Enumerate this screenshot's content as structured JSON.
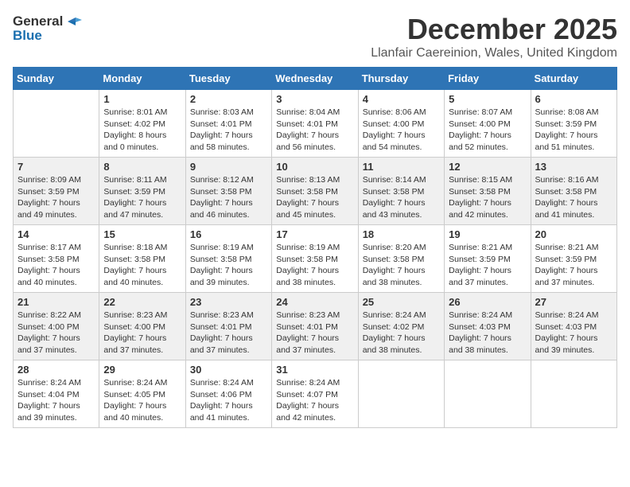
{
  "header": {
    "logo_general": "General",
    "logo_blue": "Blue",
    "month_title": "December 2025",
    "location": "Llanfair Caereinion, Wales, United Kingdom"
  },
  "days_of_week": [
    "Sunday",
    "Monday",
    "Tuesday",
    "Wednesday",
    "Thursday",
    "Friday",
    "Saturday"
  ],
  "weeks": [
    [
      {
        "day": "",
        "info": ""
      },
      {
        "day": "1",
        "info": "Sunrise: 8:01 AM\nSunset: 4:02 PM\nDaylight: 8 hours\nand 0 minutes."
      },
      {
        "day": "2",
        "info": "Sunrise: 8:03 AM\nSunset: 4:01 PM\nDaylight: 7 hours\nand 58 minutes."
      },
      {
        "day": "3",
        "info": "Sunrise: 8:04 AM\nSunset: 4:01 PM\nDaylight: 7 hours\nand 56 minutes."
      },
      {
        "day": "4",
        "info": "Sunrise: 8:06 AM\nSunset: 4:00 PM\nDaylight: 7 hours\nand 54 minutes."
      },
      {
        "day": "5",
        "info": "Sunrise: 8:07 AM\nSunset: 4:00 PM\nDaylight: 7 hours\nand 52 minutes."
      },
      {
        "day": "6",
        "info": "Sunrise: 8:08 AM\nSunset: 3:59 PM\nDaylight: 7 hours\nand 51 minutes."
      }
    ],
    [
      {
        "day": "7",
        "info": "Sunrise: 8:09 AM\nSunset: 3:59 PM\nDaylight: 7 hours\nand 49 minutes."
      },
      {
        "day": "8",
        "info": "Sunrise: 8:11 AM\nSunset: 3:59 PM\nDaylight: 7 hours\nand 47 minutes."
      },
      {
        "day": "9",
        "info": "Sunrise: 8:12 AM\nSunset: 3:58 PM\nDaylight: 7 hours\nand 46 minutes."
      },
      {
        "day": "10",
        "info": "Sunrise: 8:13 AM\nSunset: 3:58 PM\nDaylight: 7 hours\nand 45 minutes."
      },
      {
        "day": "11",
        "info": "Sunrise: 8:14 AM\nSunset: 3:58 PM\nDaylight: 7 hours\nand 43 minutes."
      },
      {
        "day": "12",
        "info": "Sunrise: 8:15 AM\nSunset: 3:58 PM\nDaylight: 7 hours\nand 42 minutes."
      },
      {
        "day": "13",
        "info": "Sunrise: 8:16 AM\nSunset: 3:58 PM\nDaylight: 7 hours\nand 41 minutes."
      }
    ],
    [
      {
        "day": "14",
        "info": "Sunrise: 8:17 AM\nSunset: 3:58 PM\nDaylight: 7 hours\nand 40 minutes."
      },
      {
        "day": "15",
        "info": "Sunrise: 8:18 AM\nSunset: 3:58 PM\nDaylight: 7 hours\nand 40 minutes."
      },
      {
        "day": "16",
        "info": "Sunrise: 8:19 AM\nSunset: 3:58 PM\nDaylight: 7 hours\nand 39 minutes."
      },
      {
        "day": "17",
        "info": "Sunrise: 8:19 AM\nSunset: 3:58 PM\nDaylight: 7 hours\nand 38 minutes."
      },
      {
        "day": "18",
        "info": "Sunrise: 8:20 AM\nSunset: 3:58 PM\nDaylight: 7 hours\nand 38 minutes."
      },
      {
        "day": "19",
        "info": "Sunrise: 8:21 AM\nSunset: 3:59 PM\nDaylight: 7 hours\nand 37 minutes."
      },
      {
        "day": "20",
        "info": "Sunrise: 8:21 AM\nSunset: 3:59 PM\nDaylight: 7 hours\nand 37 minutes."
      }
    ],
    [
      {
        "day": "21",
        "info": "Sunrise: 8:22 AM\nSunset: 4:00 PM\nDaylight: 7 hours\nand 37 minutes."
      },
      {
        "day": "22",
        "info": "Sunrise: 8:23 AM\nSunset: 4:00 PM\nDaylight: 7 hours\nand 37 minutes."
      },
      {
        "day": "23",
        "info": "Sunrise: 8:23 AM\nSunset: 4:01 PM\nDaylight: 7 hours\nand 37 minutes."
      },
      {
        "day": "24",
        "info": "Sunrise: 8:23 AM\nSunset: 4:01 PM\nDaylight: 7 hours\nand 37 minutes."
      },
      {
        "day": "25",
        "info": "Sunrise: 8:24 AM\nSunset: 4:02 PM\nDaylight: 7 hours\nand 38 minutes."
      },
      {
        "day": "26",
        "info": "Sunrise: 8:24 AM\nSunset: 4:03 PM\nDaylight: 7 hours\nand 38 minutes."
      },
      {
        "day": "27",
        "info": "Sunrise: 8:24 AM\nSunset: 4:03 PM\nDaylight: 7 hours\nand 39 minutes."
      }
    ],
    [
      {
        "day": "28",
        "info": "Sunrise: 8:24 AM\nSunset: 4:04 PM\nDaylight: 7 hours\nand 39 minutes."
      },
      {
        "day": "29",
        "info": "Sunrise: 8:24 AM\nSunset: 4:05 PM\nDaylight: 7 hours\nand 40 minutes."
      },
      {
        "day": "30",
        "info": "Sunrise: 8:24 AM\nSunset: 4:06 PM\nDaylight: 7 hours\nand 41 minutes."
      },
      {
        "day": "31",
        "info": "Sunrise: 8:24 AM\nSunset: 4:07 PM\nDaylight: 7 hours\nand 42 minutes."
      },
      {
        "day": "",
        "info": ""
      },
      {
        "day": "",
        "info": ""
      },
      {
        "day": "",
        "info": ""
      }
    ]
  ]
}
